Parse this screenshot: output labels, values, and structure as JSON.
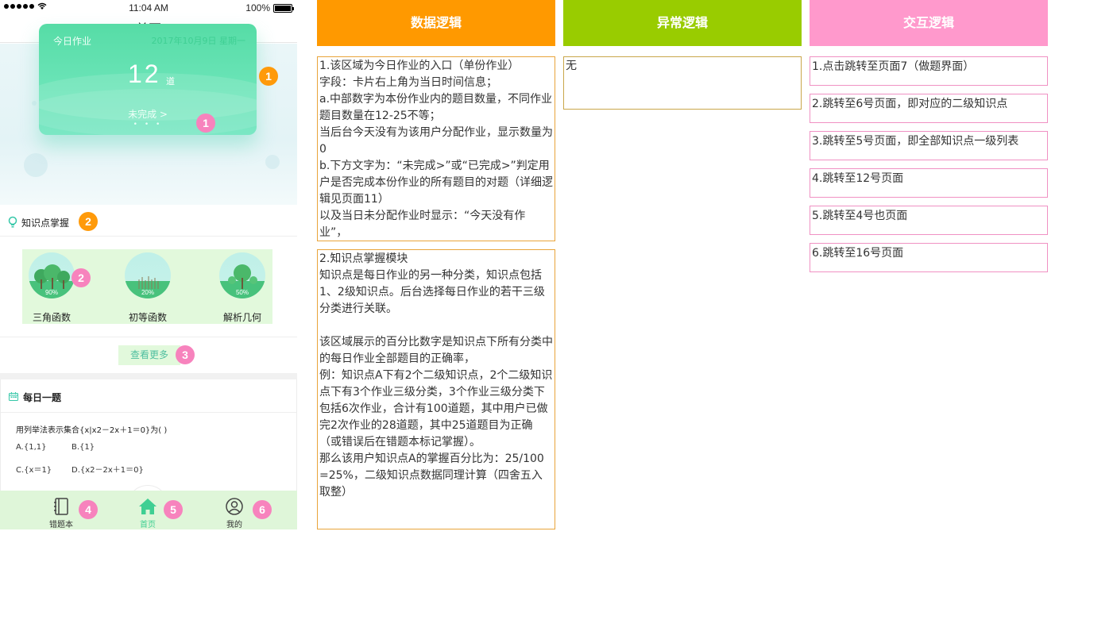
{
  "status_bar": {
    "time": "11:04 AM",
    "battery": "100%"
  },
  "nav": {
    "title": "首页"
  },
  "homework_card": {
    "label": "今日作业",
    "date": "2017年10月9日 星期一",
    "count": "12",
    "unit": "道",
    "status": "未完成 >",
    "dots": "• • •"
  },
  "badges": [
    "1",
    "1",
    "2",
    "2",
    "3",
    "4",
    "5",
    "6"
  ],
  "knowledge": {
    "title": "知识点掌握",
    "items": [
      {
        "name": "三角函数",
        "percent": "90%"
      },
      {
        "name": "初等函数",
        "percent": "20%"
      },
      {
        "name": "解析几何",
        "percent": "50%"
      }
    ],
    "more_label": "查看更多"
  },
  "daily": {
    "title": "每日一题",
    "question": "用列举法表示集合{x|x2－2x＋1＝0}为(   )",
    "options": [
      "A.{1,1}",
      "B.{1}",
      "C.{x＝1}",
      "D.{x2－2x＋1＝0}"
    ]
  },
  "tabs": [
    {
      "label": "错题本",
      "icon": "notebook-icon"
    },
    {
      "label": "首页",
      "icon": "home-icon"
    },
    {
      "label": "我的",
      "icon": "user-icon"
    }
  ],
  "columns": {
    "data_logic": {
      "title": "数据逻辑",
      "color": "#ff9900"
    },
    "exception_logic": {
      "title": "异常逻辑",
      "color": "#99cc00"
    },
    "interaction_logic": {
      "title": "交互逻辑",
      "color": "#ff99cc"
    }
  },
  "data_notes": [
    "1.该区域为今日作业的入口（单份作业）\n字段：卡片右上角为当日时间信息；\na.中部数字为本份作业内的题目数量，不同作业题目数量在12-25不等；\n当后台今天没有为该用户分配作业，显示数量为 0\nb.下方文字为：“未完成>”或“已完成>”判定用户是否完成本份作业的所有题目的对题（详细逻辑见页面11）\n以及当日未分配作业时显示：“今天没有作业”，",
    "2.知识点掌握模块\n知识点是每日作业的另一种分类，知识点包括1、2级知识点。后台选择每日作业的若干三级分类进行关联。\n\n该区域展示的百分比数字是知识点下所有分类中的每日作业全部题目的正确率，\n例：知识点A下有2个二级知识点，2个二级知识点下有3个作业三级分类，3个作业三级分类下包括6次作业，合计有100道题，其中用户已做完2次作业的28道题，其中25道题目为正确（或错误后在错题本标记掌握）。\n那么该用户知识点A的掌握百分比为：25/100=25%，二级知识点数据同理计算（四舍五入取整）"
  ],
  "exception_notes": [
    "无"
  ],
  "interaction_notes": [
    "1.点击跳转至页面7（做题界面）",
    "2.跳转至6号页面，即对应的二级知识点",
    "3.跳转至5号页面，即全部知识点一级列表",
    "4.跳转至12号页面",
    "5.跳转至4号也页面",
    "6.跳转至16号页面"
  ]
}
